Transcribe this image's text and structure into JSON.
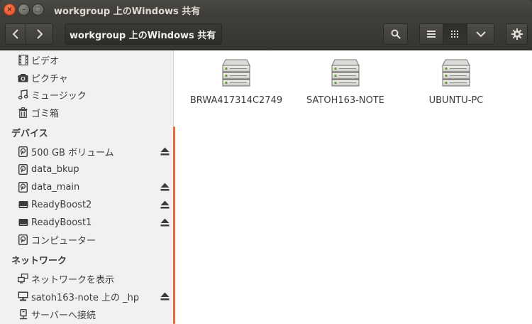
{
  "window": {
    "title": "workgroup 上のWindows 共有",
    "controls": {
      "close": "×",
      "minimize": "–",
      "maximize": "□"
    }
  },
  "toolbar": {
    "path_label": "workgroup 上のWindows 共有"
  },
  "sidebar": {
    "places": [
      {
        "label": "ビデオ",
        "icon": "video-icon"
      },
      {
        "label": "ピクチャ",
        "icon": "camera-icon"
      },
      {
        "label": "ミュージック",
        "icon": "music-icon"
      },
      {
        "label": "ゴミ箱",
        "icon": "trash-icon"
      }
    ],
    "devices_header": "デバイス",
    "devices": [
      {
        "label": "500 GB ボリューム",
        "icon": "drive-icon",
        "eject": true
      },
      {
        "label": "data_bkup",
        "icon": "drive-icon",
        "eject": false
      },
      {
        "label": "data_main",
        "icon": "drive-icon",
        "eject": true
      },
      {
        "label": "ReadyBoost2",
        "icon": "usb-drive-icon",
        "eject": true
      },
      {
        "label": "ReadyBoost1",
        "icon": "usb-drive-icon",
        "eject": true
      },
      {
        "label": "コンピューター",
        "icon": "drive-icon",
        "eject": false
      }
    ],
    "network_header": "ネットワーク",
    "network": [
      {
        "label": "ネットワークを表示",
        "icon": "network-icon",
        "eject": false
      },
      {
        "label": "satoh163-note 上の _hp",
        "icon": "network-share-icon",
        "eject": true
      },
      {
        "label": "サーバーへ接続",
        "icon": "server-connect-icon",
        "eject": false
      }
    ]
  },
  "main": {
    "hosts": [
      {
        "label": "BRWA417314C2749",
        "icon": "server-icon"
      },
      {
        "label": "SATOH163-NOTE",
        "icon": "server-icon"
      },
      {
        "label": "UBUNTU-PC",
        "icon": "server-icon"
      }
    ]
  },
  "colors": {
    "accent": "#e9693b",
    "titlebar": "#3c3b37",
    "sidebar_bg": "#f2f1f0"
  }
}
